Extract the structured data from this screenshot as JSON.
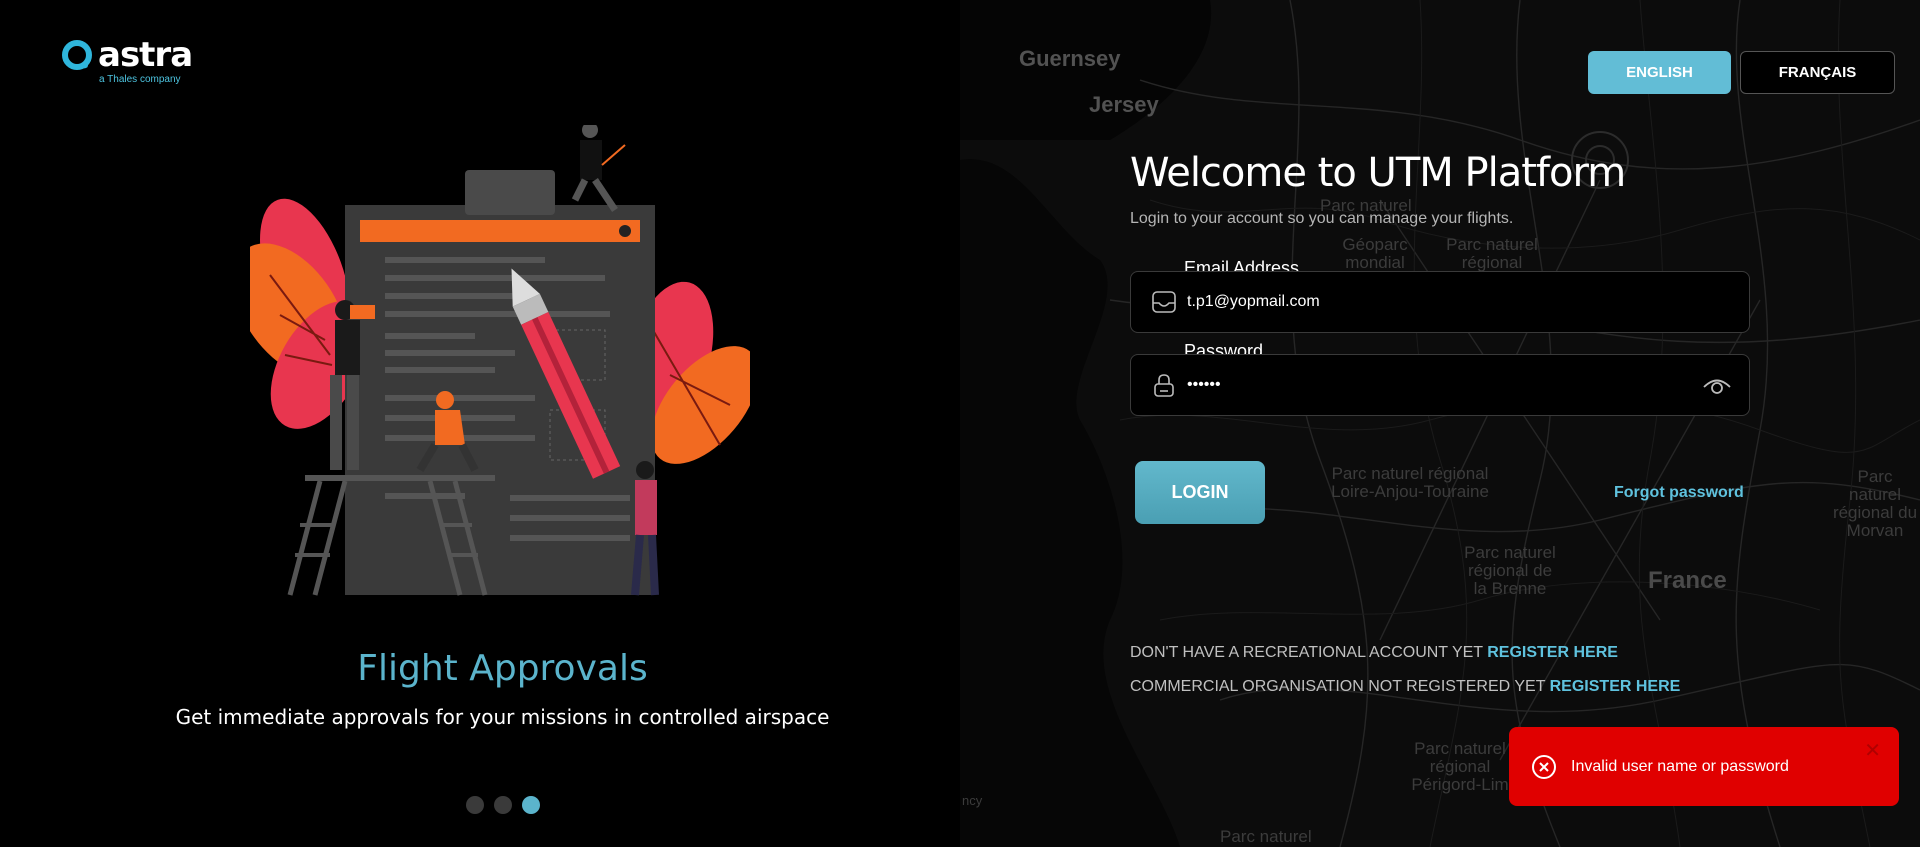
{
  "brand": {
    "name": "astra",
    "tagline": "a Thales company",
    "accent": "#5bb4cc"
  },
  "carousel": {
    "title": "Flight Approvals",
    "subtitle": "Get immediate approvals for your missions in controlled airspace",
    "slide_count": 3,
    "active_index": 2
  },
  "language": {
    "english": "ENGLISH",
    "french": "FRANÇAIS",
    "selected": "english"
  },
  "map": {
    "labels": [
      "Guernsey",
      "Jersey",
      "Parc naturel",
      "Géoparc mondial",
      "Parc naturel régional",
      "Parc naturel régional Loire-Anjou-Touraine",
      "Parc naturel régional de la Brenne",
      "France",
      "Parc naturel régional du Morvan",
      "Parc naturel régional Périgord-Lim",
      "Parc naturel",
      "ncy"
    ]
  },
  "login": {
    "title": "Welcome to UTM Platform",
    "subtitle": "Login to your account so you can manage your flights.",
    "email_label": "Email Address",
    "email_value": "t.p1@yopmail.com",
    "password_label": "Password",
    "password_value": "••••••",
    "login_button": "LOGIN",
    "forgot_password": "Forgot password"
  },
  "register": {
    "recreational_text": "DON'T HAVE A RECREATIONAL ACCOUNT YET",
    "recreational_link": "REGISTER HERE",
    "commercial_text": "COMMERCIAL ORGANISATION NOT REGISTERED YET",
    "commercial_link": "REGISTER HERE"
  },
  "toast": {
    "message": "Invalid user name or password",
    "close": "✕",
    "color": "#e00000"
  }
}
